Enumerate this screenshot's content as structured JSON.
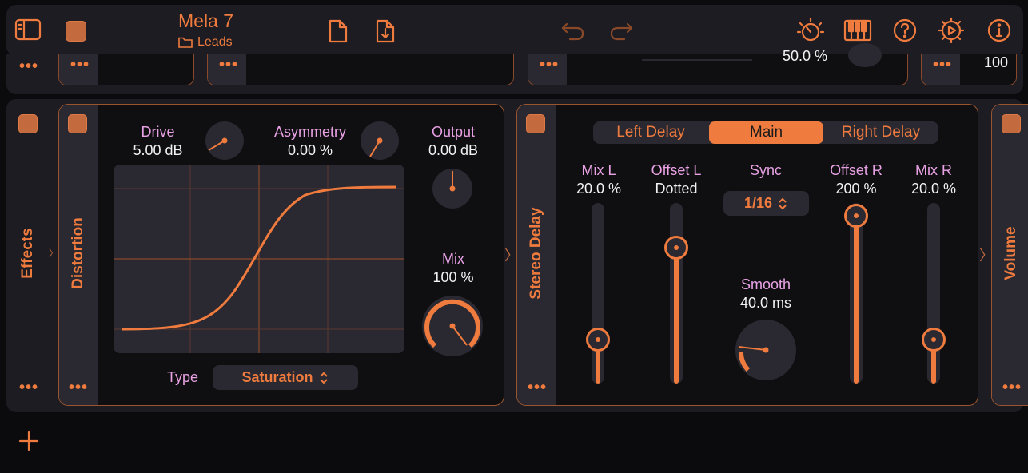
{
  "header": {
    "preset_name": "Mela 7",
    "folder_name": "Leads"
  },
  "background_strip": {
    "partial_values": [
      "50.0 %",
      "100"
    ]
  },
  "effects_panel": {
    "label": "Effects"
  },
  "distortion": {
    "title": "Distortion",
    "drive": {
      "label": "Drive",
      "value": "5.00 dB"
    },
    "asymmetry": {
      "label": "Asymmetry",
      "value": "0.00 %"
    },
    "output": {
      "label": "Output",
      "value": "0.00 dB"
    },
    "mix": {
      "label": "Mix",
      "value": "100 %",
      "level": 1.0
    },
    "type_label": "Type",
    "type_value": "Saturation"
  },
  "stereo_delay": {
    "title": "Stereo Delay",
    "tabs": [
      {
        "label": "Left Delay",
        "active": false
      },
      {
        "label": "Main",
        "active": true
      },
      {
        "label": "Right Delay",
        "active": false
      }
    ],
    "mix_l": {
      "label": "Mix L",
      "value": "20.0 %",
      "level": 0.2
    },
    "offset_l": {
      "label": "Offset L",
      "value": "Dotted",
      "level": 0.75
    },
    "sync": {
      "label": "Sync",
      "value": "1/16"
    },
    "smooth": {
      "label": "Smooth",
      "value": "40.0 ms"
    },
    "offset_r": {
      "label": "Offset R",
      "value": "200 %",
      "level": 1.0
    },
    "mix_r": {
      "label": "Mix R",
      "value": "20.0 %",
      "level": 0.2
    }
  },
  "volume_panel": {
    "label": "Volume"
  },
  "colors": {
    "accent": "#ef7b3e",
    "label": "#e9a2e4",
    "panel": "#1d1c22",
    "background": "#0b0b0d"
  }
}
